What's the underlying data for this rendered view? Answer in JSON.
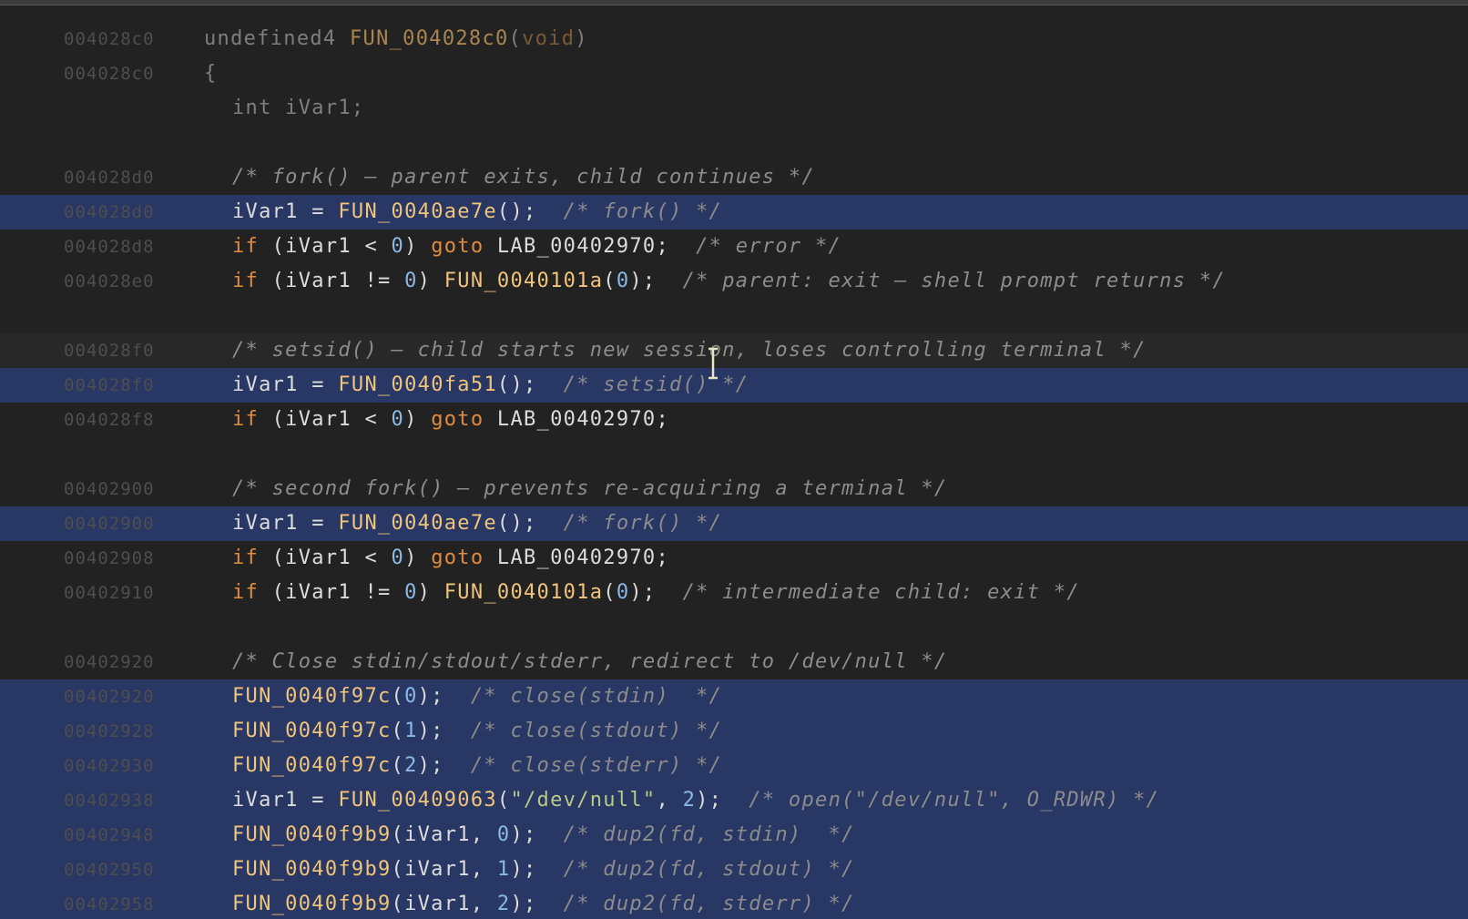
{
  "lines": [
    {
      "addr": "004028c0",
      "indent": 0,
      "bg": "none",
      "tokens": [
        {
          "t": "undefined4 ",
          "c": "dim"
        },
        {
          "t": "FUN_004028c0",
          "c": "fndim"
        },
        {
          "t": "(",
          "c": "dim"
        },
        {
          "t": "void",
          "c": "kwdim"
        },
        {
          "t": ")",
          "c": "dim"
        }
      ]
    },
    {
      "addr": "004028c0",
      "indent": 0,
      "bg": "none",
      "tokens": [
        {
          "t": "{",
          "c": "dim"
        }
      ]
    },
    {
      "addr": "",
      "indent": 1,
      "bg": "none",
      "tokens": [
        {
          "t": "int iVar1;",
          "c": "dim"
        }
      ]
    },
    {
      "addr": "",
      "indent": 0,
      "bg": "none",
      "tokens": []
    },
    {
      "addr": "004028d0",
      "indent": 1,
      "bg": "none",
      "tokens": [
        {
          "t": "/* fork() — parent exits, child continues */",
          "c": "cm"
        }
      ]
    },
    {
      "addr": "004028d0",
      "indent": 1,
      "bg": "sel",
      "tokens": [
        {
          "t": "iVar1 = ",
          "c": "plain"
        },
        {
          "t": "FUN_0040ae7e",
          "c": "fn"
        },
        {
          "t": "();  ",
          "c": "plain"
        },
        {
          "t": "/* fork() */",
          "c": "cm"
        }
      ]
    },
    {
      "addr": "004028d8",
      "indent": 1,
      "bg": "none",
      "tokens": [
        {
          "t": "if",
          "c": "kw"
        },
        {
          "t": " (iVar1 < ",
          "c": "plain"
        },
        {
          "t": "0",
          "c": "num"
        },
        {
          "t": ") ",
          "c": "plain"
        },
        {
          "t": "goto",
          "c": "kw"
        },
        {
          "t": " LAB_00402970;  ",
          "c": "plain"
        },
        {
          "t": "/* error */",
          "c": "cm"
        }
      ]
    },
    {
      "addr": "004028e0",
      "indent": 1,
      "bg": "none",
      "tokens": [
        {
          "t": "if",
          "c": "kw"
        },
        {
          "t": " (iVar1 != ",
          "c": "plain"
        },
        {
          "t": "0",
          "c": "num"
        },
        {
          "t": ") ",
          "c": "plain"
        },
        {
          "t": "FUN_0040101a",
          "c": "fn"
        },
        {
          "t": "(",
          "c": "plain"
        },
        {
          "t": "0",
          "c": "num"
        },
        {
          "t": ");  ",
          "c": "plain"
        },
        {
          "t": "/* parent: exit — shell prompt returns */",
          "c": "cm"
        }
      ]
    },
    {
      "addr": "",
      "indent": 0,
      "bg": "none",
      "tokens": []
    },
    {
      "addr": "004028f0",
      "indent": 1,
      "bg": "cur",
      "tokens": [
        {
          "t": "/* setsid() — child starts new session, loses controlling terminal */",
          "c": "cm"
        }
      ]
    },
    {
      "addr": "004028f0",
      "indent": 1,
      "bg": "sel",
      "tokens": [
        {
          "t": "iVar1 = ",
          "c": "plain"
        },
        {
          "t": "FUN_0040fa51",
          "c": "fn"
        },
        {
          "t": "();  ",
          "c": "plain"
        },
        {
          "t": "/* setsid() */",
          "c": "cm"
        }
      ]
    },
    {
      "addr": "004028f8",
      "indent": 1,
      "bg": "none",
      "tokens": [
        {
          "t": "if",
          "c": "kw"
        },
        {
          "t": " (iVar1 < ",
          "c": "plain"
        },
        {
          "t": "0",
          "c": "num"
        },
        {
          "t": ") ",
          "c": "plain"
        },
        {
          "t": "goto",
          "c": "kw"
        },
        {
          "t": " LAB_00402970;",
          "c": "plain"
        }
      ]
    },
    {
      "addr": "",
      "indent": 0,
      "bg": "none",
      "tokens": []
    },
    {
      "addr": "00402900",
      "indent": 1,
      "bg": "none",
      "tokens": [
        {
          "t": "/* second fork() — prevents re-acquiring a terminal */",
          "c": "cm"
        }
      ]
    },
    {
      "addr": "00402900",
      "indent": 1,
      "bg": "sel",
      "tokens": [
        {
          "t": "iVar1 = ",
          "c": "plain"
        },
        {
          "t": "FUN_0040ae7e",
          "c": "fn"
        },
        {
          "t": "();  ",
          "c": "plain"
        },
        {
          "t": "/* fork() */",
          "c": "cm"
        }
      ]
    },
    {
      "addr": "00402908",
      "indent": 1,
      "bg": "none",
      "tokens": [
        {
          "t": "if",
          "c": "kw"
        },
        {
          "t": " (iVar1 < ",
          "c": "plain"
        },
        {
          "t": "0",
          "c": "num"
        },
        {
          "t": ") ",
          "c": "plain"
        },
        {
          "t": "goto",
          "c": "kw"
        },
        {
          "t": " LAB_00402970;",
          "c": "plain"
        }
      ]
    },
    {
      "addr": "00402910",
      "indent": 1,
      "bg": "none",
      "tokens": [
        {
          "t": "if",
          "c": "kw"
        },
        {
          "t": " (iVar1 != ",
          "c": "plain"
        },
        {
          "t": "0",
          "c": "num"
        },
        {
          "t": ") ",
          "c": "plain"
        },
        {
          "t": "FUN_0040101a",
          "c": "fn"
        },
        {
          "t": "(",
          "c": "plain"
        },
        {
          "t": "0",
          "c": "num"
        },
        {
          "t": ");  ",
          "c": "plain"
        },
        {
          "t": "/* intermediate child: exit */",
          "c": "cm"
        }
      ]
    },
    {
      "addr": "",
      "indent": 0,
      "bg": "none",
      "tokens": []
    },
    {
      "addr": "00402920",
      "indent": 1,
      "bg": "none",
      "tokens": [
        {
          "t": "/* Close stdin/stdout/stderr, redirect to /dev/null */",
          "c": "cm"
        }
      ]
    },
    {
      "addr": "00402920",
      "indent": 1,
      "bg": "sel",
      "tokens": [
        {
          "t": "FUN_0040f97c",
          "c": "fn"
        },
        {
          "t": "(",
          "c": "plain"
        },
        {
          "t": "0",
          "c": "num"
        },
        {
          "t": ");  ",
          "c": "plain"
        },
        {
          "t": "/* close(stdin)  */",
          "c": "cm"
        }
      ]
    },
    {
      "addr": "00402928",
      "indent": 1,
      "bg": "sel",
      "tokens": [
        {
          "t": "FUN_0040f97c",
          "c": "fn"
        },
        {
          "t": "(",
          "c": "plain"
        },
        {
          "t": "1",
          "c": "num"
        },
        {
          "t": ");  ",
          "c": "plain"
        },
        {
          "t": "/* close(stdout) */",
          "c": "cm"
        }
      ]
    },
    {
      "addr": "00402930",
      "indent": 1,
      "bg": "sel",
      "tokens": [
        {
          "t": "FUN_0040f97c",
          "c": "fn"
        },
        {
          "t": "(",
          "c": "plain"
        },
        {
          "t": "2",
          "c": "num"
        },
        {
          "t": ");  ",
          "c": "plain"
        },
        {
          "t": "/* close(stderr) */",
          "c": "cm"
        }
      ]
    },
    {
      "addr": "00402938",
      "indent": 1,
      "bg": "sel",
      "tokens": [
        {
          "t": "iVar1 = ",
          "c": "plain"
        },
        {
          "t": "FUN_00409063",
          "c": "fn"
        },
        {
          "t": "(",
          "c": "plain"
        },
        {
          "t": "\"/dev/null\"",
          "c": "str"
        },
        {
          "t": ", ",
          "c": "plain"
        },
        {
          "t": "2",
          "c": "num"
        },
        {
          "t": ");  ",
          "c": "plain"
        },
        {
          "t": "/* open(\"/dev/null\", O_RDWR) */",
          "c": "cm"
        }
      ]
    },
    {
      "addr": "00402948",
      "indent": 1,
      "bg": "sel",
      "tokens": [
        {
          "t": "FUN_0040f9b9",
          "c": "fn"
        },
        {
          "t": "(iVar1, ",
          "c": "plain"
        },
        {
          "t": "0",
          "c": "num"
        },
        {
          "t": ");  ",
          "c": "plain"
        },
        {
          "t": "/* dup2(fd, stdin)  */",
          "c": "cm"
        }
      ]
    },
    {
      "addr": "00402950",
      "indent": 1,
      "bg": "sel",
      "tokens": [
        {
          "t": "FUN_0040f9b9",
          "c": "fn"
        },
        {
          "t": "(iVar1, ",
          "c": "plain"
        },
        {
          "t": "1",
          "c": "num"
        },
        {
          "t": ");  ",
          "c": "plain"
        },
        {
          "t": "/* dup2(fd, stdout) */",
          "c": "cm"
        }
      ]
    },
    {
      "addr": "00402958",
      "indent": 1,
      "bg": "sel",
      "tokens": [
        {
          "t": "FUN_0040f9b9",
          "c": "fn"
        },
        {
          "t": "(iVar1, ",
          "c": "plain"
        },
        {
          "t": "2",
          "c": "num"
        },
        {
          "t": ");  ",
          "c": "plain"
        },
        {
          "t": "/* dup2(fd, stderr) */",
          "c": "cm"
        }
      ]
    }
  ],
  "colors": {
    "background": "#222222",
    "selection": "#283764",
    "address": "#4e4e4e",
    "function": "#f0c47a",
    "keyword": "#e08c3c",
    "number": "#8cb8e6",
    "string": "#b9c987",
    "comment": "#8c8c8c"
  },
  "cursor_icon": "text-cursor-icon"
}
